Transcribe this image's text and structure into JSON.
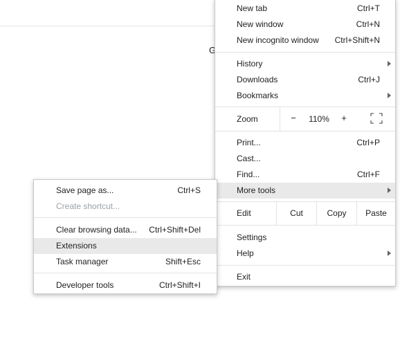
{
  "background": {
    "glyph": "G"
  },
  "menu": {
    "items": {
      "new_tab": {
        "label": "New tab",
        "shortcut": "Ctrl+T"
      },
      "new_window": {
        "label": "New window",
        "shortcut": "Ctrl+N"
      },
      "new_incognito": {
        "label": "New incognito window",
        "shortcut": "Ctrl+Shift+N"
      },
      "history": {
        "label": "History"
      },
      "downloads": {
        "label": "Downloads",
        "shortcut": "Ctrl+J"
      },
      "bookmarks": {
        "label": "Bookmarks"
      },
      "print": {
        "label": "Print...",
        "shortcut": "Ctrl+P"
      },
      "cast": {
        "label": "Cast..."
      },
      "find": {
        "label": "Find...",
        "shortcut": "Ctrl+F"
      },
      "more_tools": {
        "label": "More tools"
      },
      "settings": {
        "label": "Settings"
      },
      "help": {
        "label": "Help"
      },
      "exit": {
        "label": "Exit"
      }
    },
    "zoom": {
      "label": "Zoom",
      "minus": "−",
      "value": "110%",
      "plus": "+",
      "fullscreen_icon": "fullscreen-icon"
    },
    "edit": {
      "label": "Edit",
      "cut": "Cut",
      "copy": "Copy",
      "paste": "Paste"
    }
  },
  "submenu": {
    "items": {
      "save_page": {
        "label": "Save page as...",
        "shortcut": "Ctrl+S"
      },
      "create_shortcut": {
        "label": "Create shortcut...",
        "disabled": true
      },
      "clear_browsing": {
        "label": "Clear browsing data...",
        "shortcut": "Ctrl+Shift+Del"
      },
      "extensions": {
        "label": "Extensions"
      },
      "task_manager": {
        "label": "Task manager",
        "shortcut": "Shift+Esc"
      },
      "developer_tools": {
        "label": "Developer tools",
        "shortcut": "Ctrl+Shift+I"
      }
    }
  },
  "colors": {
    "highlight": "#e9e9e9",
    "text": "#202124",
    "disabled_text": "#9aa0a6",
    "separator": "#e2e2e2"
  }
}
